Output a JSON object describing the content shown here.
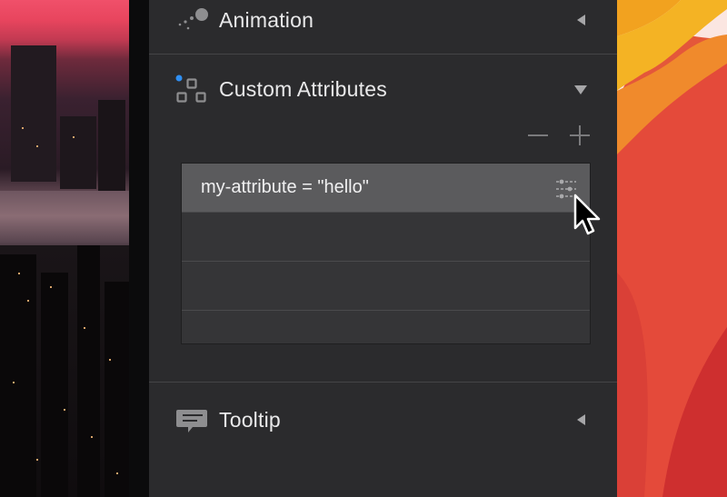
{
  "sections": [
    {
      "title": "Animation",
      "icon": "animation-icon",
      "state": "collapsed"
    },
    {
      "title": "Custom Attributes",
      "icon": "custom-attributes-icon",
      "state": "expanded"
    },
    {
      "title": "Tooltip",
      "icon": "tooltip-icon",
      "state": "collapsed"
    }
  ],
  "custom_attributes": {
    "remove_icon": "minus-icon",
    "add_icon": "plus-icon",
    "rows": [
      {
        "text": "my-attribute = \"hello\"",
        "selected": true
      },
      {
        "text": "",
        "selected": false
      },
      {
        "text": "",
        "selected": false
      },
      {
        "text": "",
        "selected": false
      }
    ]
  },
  "colors": {
    "panel_bg": "#2b2b2d",
    "row_selected": "#5b5b5d",
    "accent_blue": "#2f8ff3",
    "text": "#e9e9ea"
  }
}
